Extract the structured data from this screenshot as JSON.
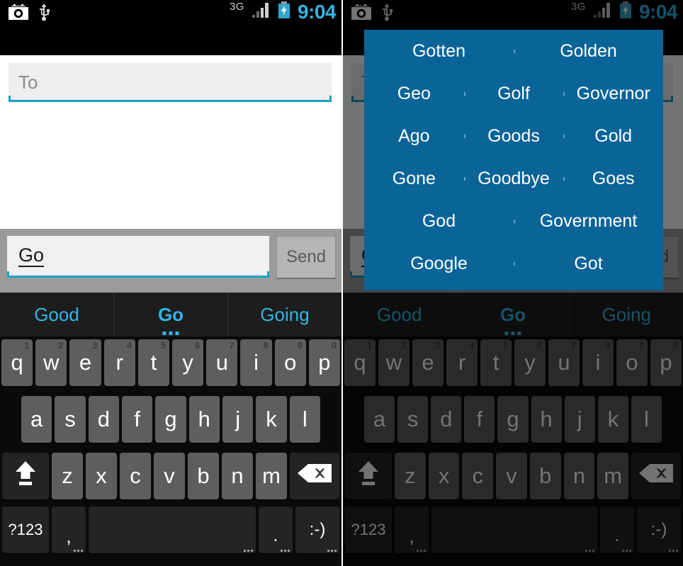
{
  "status_bar": {
    "icons": [
      "camera-icon",
      "usb-icon"
    ],
    "network_type": "3G",
    "signal": "signal-bars-icon",
    "battery": "battery-charging-icon",
    "clock": "9:04",
    "clock_color": "#33b5e5"
  },
  "compose_screen": {
    "to_field": {
      "placeholder": "To",
      "value": ""
    },
    "message_field": {
      "value": "Go",
      "placeholder": ""
    },
    "send_button": {
      "label": "Send"
    }
  },
  "suggestion_strip": {
    "items": [
      {
        "label": "Good",
        "active": false,
        "has_more": false
      },
      {
        "label": "Go",
        "active": true,
        "has_more": true
      },
      {
        "label": "Going",
        "active": false,
        "has_more": false
      }
    ]
  },
  "keyboard": {
    "row1": [
      {
        "key": "q",
        "alt": "1"
      },
      {
        "key": "w",
        "alt": "2"
      },
      {
        "key": "e",
        "alt": "3"
      },
      {
        "key": "r",
        "alt": "4"
      },
      {
        "key": "t",
        "alt": "5"
      },
      {
        "key": "y",
        "alt": "6"
      },
      {
        "key": "u",
        "alt": "7"
      },
      {
        "key": "i",
        "alt": "8"
      },
      {
        "key": "o",
        "alt": "9"
      },
      {
        "key": "p",
        "alt": "0"
      }
    ],
    "row2": [
      {
        "key": "a"
      },
      {
        "key": "s"
      },
      {
        "key": "d"
      },
      {
        "key": "f"
      },
      {
        "key": "g"
      },
      {
        "key": "h"
      },
      {
        "key": "j"
      },
      {
        "key": "k"
      },
      {
        "key": "l"
      }
    ],
    "row3": [
      {
        "key": "z"
      },
      {
        "key": "x"
      },
      {
        "key": "c"
      },
      {
        "key": "v"
      },
      {
        "key": "b"
      },
      {
        "key": "n"
      },
      {
        "key": "m"
      }
    ],
    "shift_key": "shift-icon",
    "delete_key": "backspace-icon",
    "row4": {
      "symbols": "?123",
      "comma": ",",
      "space": "",
      "period": ".",
      "smiley": ":-)"
    }
  },
  "word_popup": {
    "background_color": "#0b6498",
    "rows": [
      [
        "Gotten",
        "Golden"
      ],
      [
        "Geo",
        "Golf",
        "Governor"
      ],
      [
        "Ago",
        "Goods",
        "Gold"
      ],
      [
        "Gone",
        "Goodbye",
        "Goes"
      ],
      [
        "God",
        "Government"
      ],
      [
        "Google",
        "Got"
      ]
    ]
  }
}
